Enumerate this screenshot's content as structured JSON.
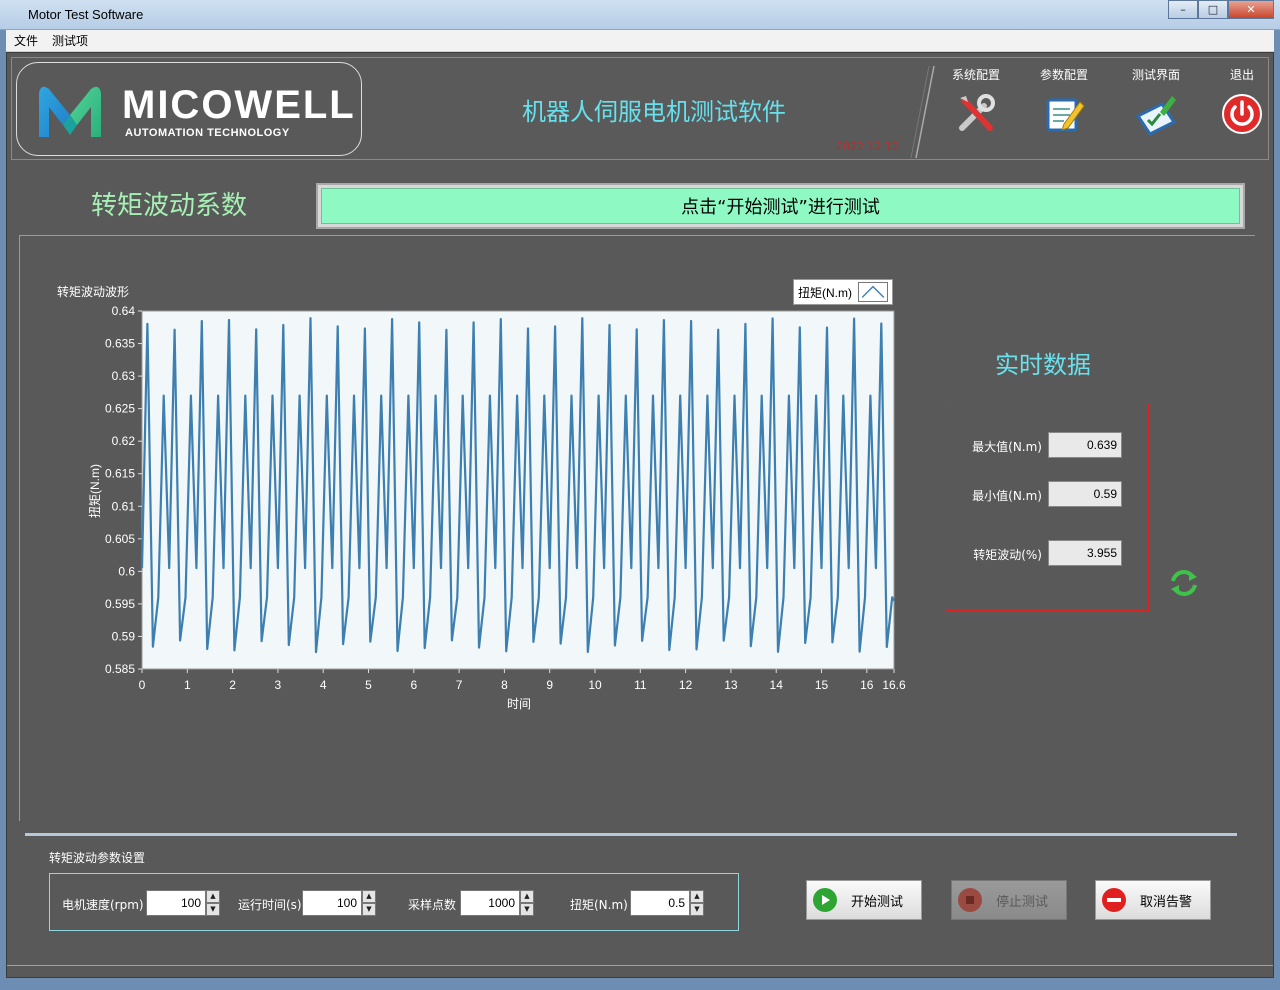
{
  "window": {
    "title": "Motor Test Software",
    "min": "–",
    "max": "□",
    "close": "✕"
  },
  "menu": [
    "文件",
    "测试项"
  ],
  "header": {
    "logo_text": "MICOWELL",
    "logo_sub": "AUTOMATION TECHNOLOGY",
    "app_title": "机器人伺服电机测试软件",
    "date": "2022.12.12",
    "nav": [
      {
        "label": "系统配置",
        "icon": "tools-icon"
      },
      {
        "label": "参数配置",
        "icon": "notepad-edit-icon"
      },
      {
        "label": "测试界面",
        "icon": "clipboard-check-icon"
      },
      {
        "label": "退出",
        "icon": "power-icon"
      }
    ]
  },
  "section_title": "转矩波动系数",
  "status_text": "点击“开始测试”进行测试",
  "chart_data": {
    "type": "line",
    "title": "转矩波动波形",
    "xlabel": "时间",
    "ylabel": "扭矩(N.m)",
    "xlim": [
      0,
      16.6
    ],
    "ylim": [
      0.585,
      0.64
    ],
    "xticks": [
      "0",
      "1",
      "2",
      "3",
      "4",
      "5",
      "6",
      "7",
      "8",
      "9",
      "10",
      "11",
      "12",
      "13",
      "14",
      "15",
      "16",
      "16.6"
    ],
    "yticks": [
      "0.64",
      "0.635",
      "0.63",
      "0.625",
      "0.62",
      "0.615",
      "0.61",
      "0.605",
      "0.6",
      "0.595",
      "0.59",
      "0.585"
    ],
    "grid": false,
    "legend_position": "top-right",
    "series": [
      {
        "name": "扭矩(N.m)",
        "color": "#3d7fb0",
        "period": 0.6,
        "cycle_points": [
          0.6005,
          0.638,
          0.5885,
          0.596,
          0.627,
          0.6005
        ]
      }
    ]
  },
  "realtime": {
    "title": "实时数据",
    "rows": [
      {
        "label": "最大值(N.m)",
        "value": "0.639"
      },
      {
        "label": "最小值(N.m)",
        "value": "0.59"
      },
      {
        "label": "转矩波动(%)",
        "value": "3.955"
      }
    ]
  },
  "params": {
    "title": "转矩波动参数设置",
    "fields": [
      {
        "label": "电机速度(rpm)",
        "value": "100"
      },
      {
        "label": "运行时间(s)",
        "value": "100"
      },
      {
        "label": "采样点数",
        "value": "1000"
      },
      {
        "label": "扭矩(N.m)",
        "value": "0.5"
      }
    ]
  },
  "buttons": {
    "start": "开始测试",
    "stop": "停止测试",
    "cancel_alarm": "取消告警"
  },
  "colors": {
    "accent": "#66e0ec",
    "status_bg": "#8ef9c3",
    "section_title": "#a6f0b4",
    "line": "#3d7fb0"
  }
}
